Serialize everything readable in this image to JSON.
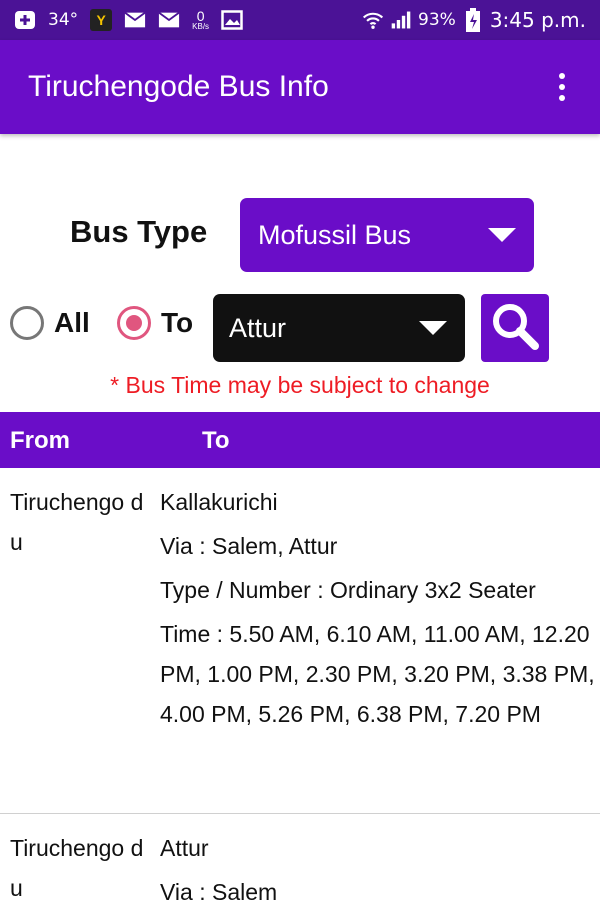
{
  "status_bar": {
    "temperature": "34°",
    "battery": "93%",
    "time": "3:45 p.m.",
    "net_speed_value": "0",
    "net_speed_unit": "KB/s",
    "icons": [
      "plus-icon",
      "yandex-icon",
      "mail-icon",
      "mail-icon",
      "network-speed-icon",
      "image-icon",
      "wifi-icon",
      "signal-icon",
      "battery-icon"
    ]
  },
  "app_bar": {
    "title": "Tiruchengode Bus Info",
    "menu_icon": "overflow-menu-icon"
  },
  "bus_type": {
    "label": "Bus Type",
    "selected": "Mofussil Bus"
  },
  "filter": {
    "radio_all_label": "All",
    "radio_to_label": "To",
    "selected_radio": "To",
    "destination_selected": "Attur",
    "search_icon": "search-icon"
  },
  "notice": "* Bus Time may be subject to change",
  "table": {
    "headers": {
      "from": "From",
      "to": "To"
    },
    "rows": [
      {
        "from": "Tiruchengo du",
        "to": "Kallakurichi",
        "via": "Via : Salem, Attur",
        "type": "Type / Number :  Ordinary 3x2 Seater",
        "time": "Time : 5.50 AM,  6.10 AM,  11.00 AM, 12.20 PM,  1.00 PM,  2.30 PM,  3.20 PM,  3.38 PM,  4.00 PM,  5.26 PM, 6.38 PM,  7.20 PM"
      },
      {
        "from": "Tiruchengo du",
        "to": "Attur",
        "via": "Via : Salem"
      }
    ]
  },
  "colors": {
    "status_bar": "#4b1296",
    "primary": "#6a0dc8",
    "notice": "#ee1c24",
    "radio_accent": "#e0567f"
  }
}
